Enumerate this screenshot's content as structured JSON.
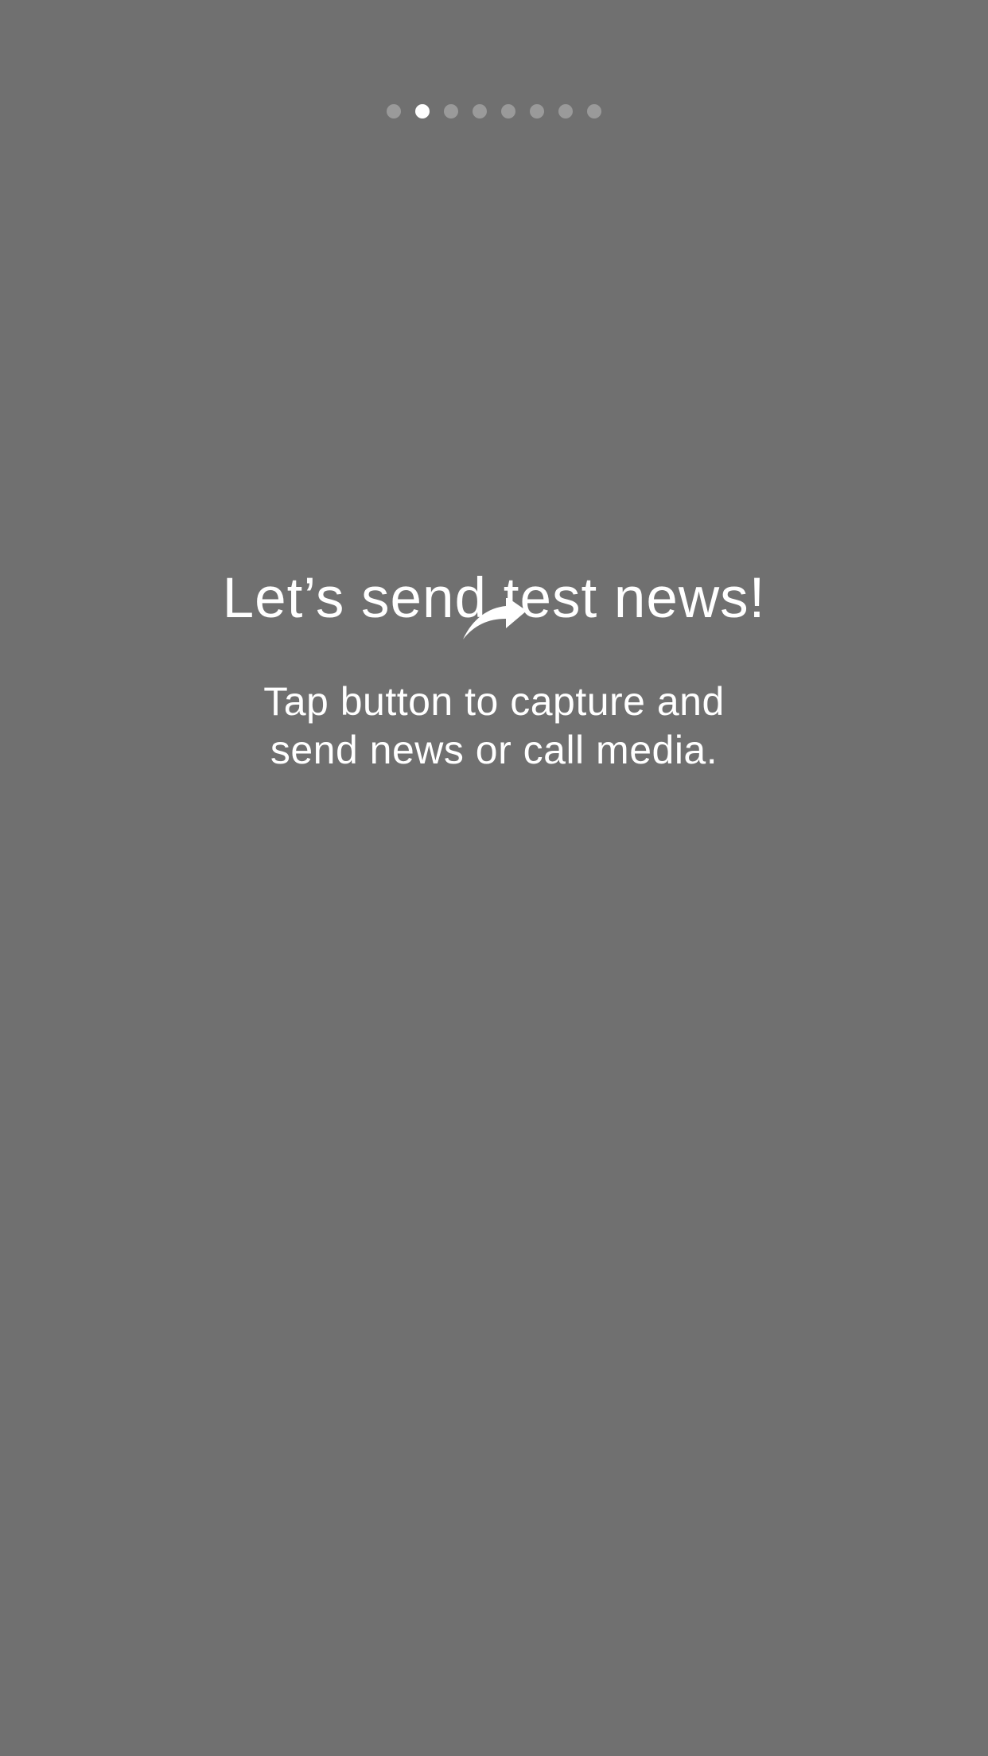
{
  "onboarding": {
    "page_indicator": {
      "total_pages": 8,
      "current_page": 2
    },
    "title": "Let’s send test news!",
    "subtitle_lines": [
      "Tap button to capture and",
      "send news or call media."
    ],
    "arrow_icon": "curved-arrow-icon"
  },
  "colors": {
    "background": "#707070",
    "text": "#ffffff",
    "dot_inactive": "#9a9a9a",
    "dot_active": "#ffffff"
  }
}
